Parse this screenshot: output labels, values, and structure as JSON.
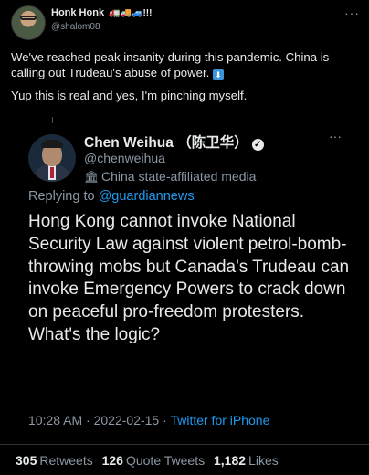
{
  "outer": {
    "name": "Honk Honk",
    "name_emojis": "🚛🚚🚙!!!",
    "handle": "@shalom08",
    "more": "···",
    "text_line1": "We've reached peak insanity during this pandemic. China is calling out Trudeau's abuse of power.",
    "arrow_emoji": "⬇",
    "text_line2": "Yup this is real and yes, I'm pinching myself."
  },
  "quote": {
    "name": "Chen Weihua （陈卫华）",
    "verified_glyph": "✓",
    "handle": "@chenweihua",
    "affiliation": "China state-affiliated media",
    "gov_icon": "🏛",
    "more": "···",
    "replying_prefix": "Replying to",
    "replying_to": "@guardiannews",
    "body": "Hong Kong cannot invoke National Security Law against violent petrol-bomb-throwing mobs but Canada's Trudeau can invoke Emergency Powers to crack down on peaceful pro-freedom protesters. What's the logic?",
    "time": "10:28 AM",
    "date": "2022-02-15",
    "sep": "·",
    "source": "Twitter for iPhone"
  },
  "stats": {
    "retweets_count": "305",
    "retweets_label": "Retweets",
    "quotes_count": "126",
    "quotes_label": "Quote Tweets",
    "likes_count": "1,182",
    "likes_label": "Likes"
  }
}
